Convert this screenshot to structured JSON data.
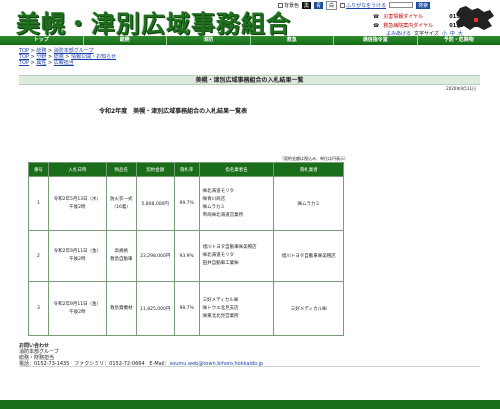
{
  "header": {
    "site_title": "美幌・津別広域事務組合",
    "util": {
      "background_color": "背景色",
      "color_black": "黒",
      "color_blue": "青",
      "color_white": "白",
      "furigana": "ふりがなをうける",
      "yomiage": "よみあげる",
      "font_size": "文字サイズ",
      "size_small": "小",
      "size_medium": "中",
      "size_large": "大",
      "search_button": "検索"
    },
    "phones": [
      {
        "label": "災害情報ダイヤル",
        "number": "0152-72-0859"
      },
      {
        "label": "救急病院案内ダイヤル",
        "number": "0152-72-1699"
      }
    ]
  },
  "nav": {
    "items": [
      "トップ",
      "総務",
      "消防",
      "救急",
      "通信指令室",
      "予防・危険物"
    ]
  },
  "breadcrumbs": [
    [
      "TOP",
      "総務",
      "消防本部グループ"
    ],
    [
      "TOP",
      "分野",
      "総務",
      "情報公開・お知らせ"
    ],
    [
      "TOP",
      "属性",
      "広報担当"
    ]
  ],
  "page": {
    "title": "美幌・津別広域事務組合の入札結果一覧",
    "date": "2020年9月11日",
    "heading": "令和2年度　美幌・津別広域事務組合の入札結果一覧表",
    "unit_note": "（契約金額は税込み、単位は円表示）"
  },
  "table": {
    "headers": [
      "番号",
      "入札日時",
      "物品名",
      "契約金額",
      "落札率",
      "指名業者名",
      "落札業者"
    ],
    "rows": [
      {
        "no": "1",
        "date": "令和2年5月13日（水）",
        "time": "午後2時",
        "item": [
          "防火衣一式",
          "（16着）"
        ],
        "amount": "5,808,000円",
        "rate": "99.7%",
        "bidders": [
          "㈱北海道モリタ",
          "㈱青川商店",
          "㈱ムラカミ",
          "帝商㈱北海道営業所"
        ],
        "winner": "㈱ムラカミ"
      },
      {
        "no": "2",
        "date": "令和2年9月11日（金）",
        "time": "午後2時",
        "item": [
          "高規格",
          "救急自動車"
        ],
        "amount": "23,298,000円",
        "rate": "93.9%",
        "bidders": [
          "旭川トヨタ自動車㈱美幌店",
          "㈱北海道モリタ",
          "田井自動車工業㈱"
        ],
        "winner": "旭川トヨタ自動車㈱美幌店"
      },
      {
        "no": "3",
        "date": "令和2年9月11日（金）",
        "time": "午後2時",
        "item": [
          "救急資機材"
        ],
        "amount": "11,825,000円",
        "rate": "98.7%",
        "bidders": [
          "三好メディカル㈱",
          "㈱トウエ北見支店",
          "㈱東北北見営業所"
        ],
        "winner": "三好メディカル㈱"
      }
    ]
  },
  "contact": {
    "heading": "お問い合わせ",
    "group": "消防本部グループ",
    "dept": "総務・財務担当",
    "tel": "電話：0152-73-1435",
    "fax": "ファクシミリ：0152-72-0664",
    "email_label": "E-Mail：",
    "email": "soumu.web@town.bihoro.hokkaido.jp"
  },
  "colors": {
    "brand_green": "#1a6e1a",
    "title_bar": "#dfeadf"
  }
}
